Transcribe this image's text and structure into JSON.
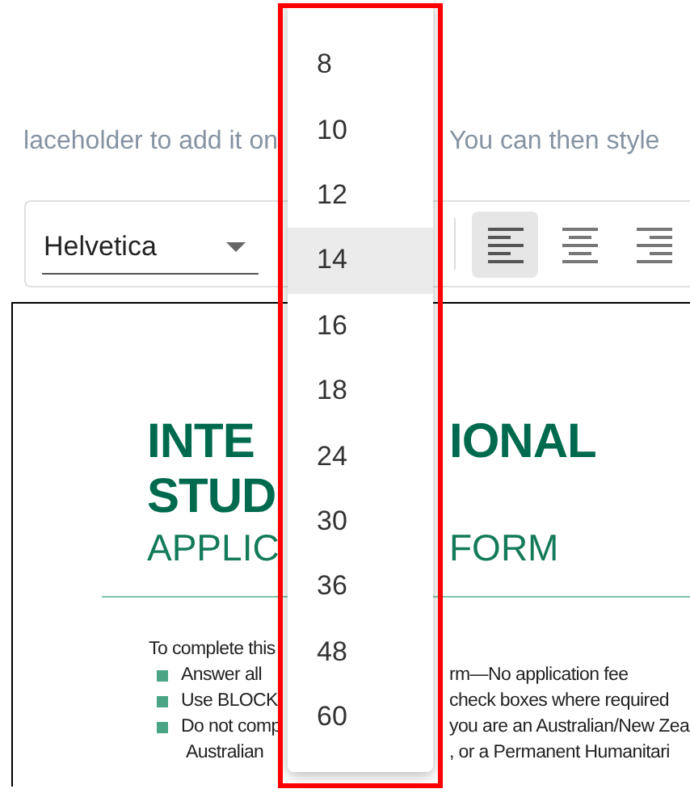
{
  "hint": {
    "text_before": "laceholder to add it on",
    "text_after": "You can then style"
  },
  "toolbar": {
    "font_select": {
      "value": "Helvetica"
    },
    "align_buttons": [
      {
        "kind": "left",
        "selected": true
      },
      {
        "kind": "center",
        "selected": false
      },
      {
        "kind": "right",
        "selected": false
      }
    ]
  },
  "document": {
    "lines": [
      {
        "kind": "title",
        "left": "INTE",
        "right": "IONAL"
      },
      {
        "kind": "title",
        "left": "STUD"
      },
      {
        "kind": "subtitle",
        "left": "APPLIC",
        "right": "FORM"
      },
      {
        "kind": "rule"
      },
      {
        "kind": "heading",
        "left": "To complete this"
      },
      {
        "kind": "bullet",
        "left": "Answer all",
        "right": "rm—No application fee"
      },
      {
        "kind": "bullet",
        "left": "Use BLOCK",
        "right": "check boxes where required"
      },
      {
        "kind": "bullet",
        "left": "Do not comp",
        "right": "you are an Australian/New Zea"
      },
      {
        "kind": "continuation",
        "left": "Australian",
        "right": ", or a Permanent Humanitari"
      }
    ]
  },
  "font_size_menu": {
    "options": [
      {
        "label": "8",
        "selected": false
      },
      {
        "label": "10",
        "selected": false
      },
      {
        "label": "12",
        "selected": false
      },
      {
        "label": "14",
        "selected": true
      },
      {
        "label": "16",
        "selected": false
      },
      {
        "label": "18",
        "selected": false
      },
      {
        "label": "24",
        "selected": false
      },
      {
        "label": "30",
        "selected": false
      },
      {
        "label": "36",
        "selected": false
      },
      {
        "label": "48",
        "selected": false
      },
      {
        "label": "60",
        "selected": false
      }
    ]
  }
}
